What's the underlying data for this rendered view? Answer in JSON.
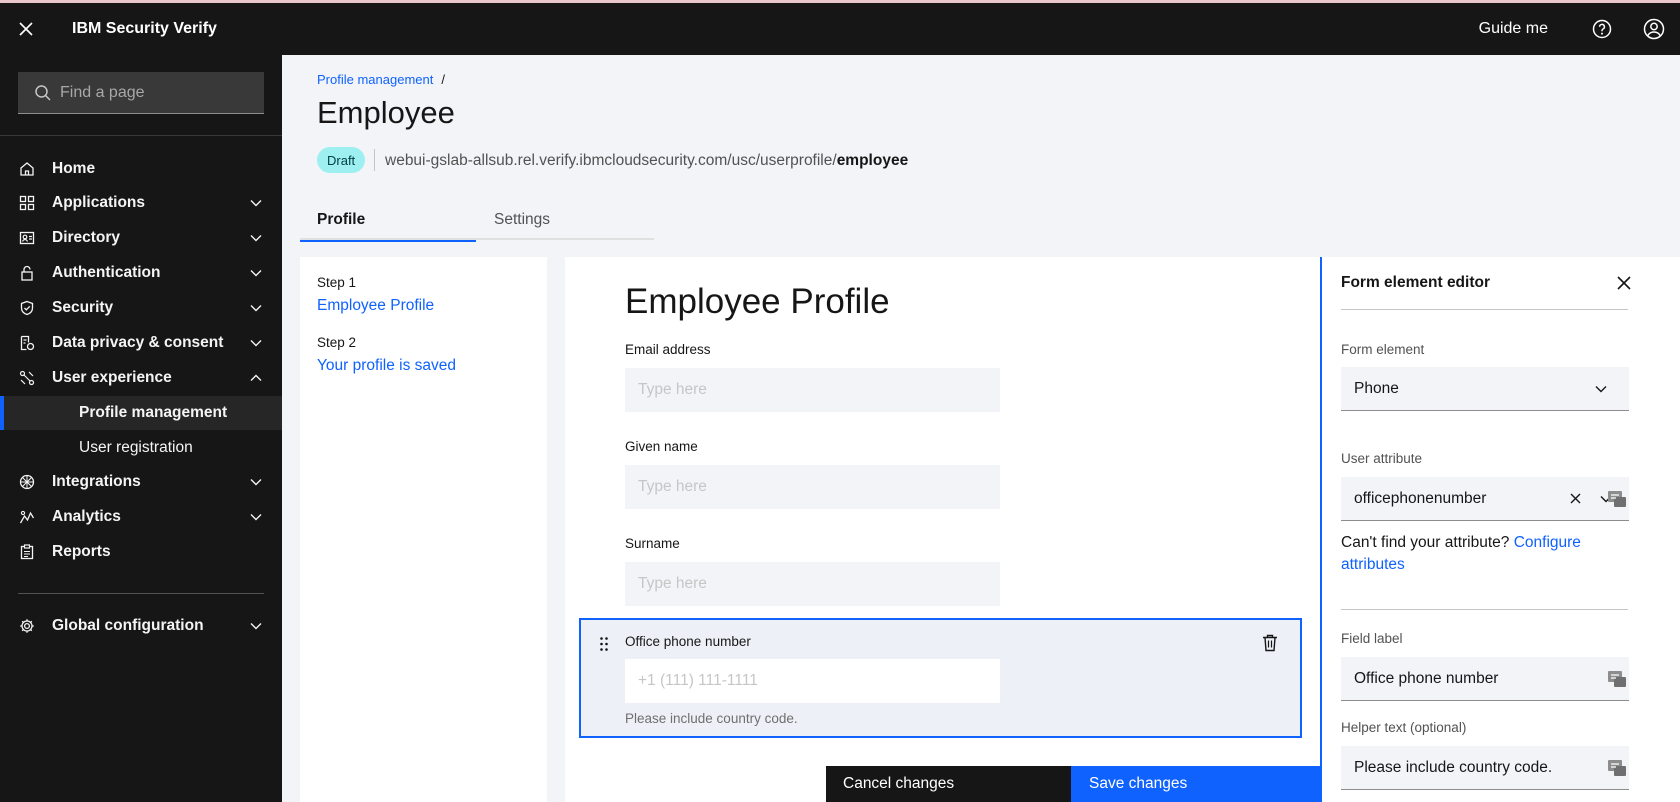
{
  "header": {
    "brand": "IBM Security Verify",
    "guide_me": "Guide me"
  },
  "sidebar": {
    "search_placeholder": "Find a page",
    "items": [
      {
        "label": "Home",
        "icon": "home-icon"
      },
      {
        "label": "Applications",
        "icon": "applications-icon"
      },
      {
        "label": "Directory",
        "icon": "directory-icon"
      },
      {
        "label": "Authentication",
        "icon": "lock-icon"
      },
      {
        "label": "Security",
        "icon": "shield-icon"
      },
      {
        "label": "Data privacy & consent",
        "icon": "data-privacy-icon"
      },
      {
        "label": "User experience",
        "icon": "user-experience-icon"
      },
      {
        "label": "Integrations",
        "icon": "integrations-icon"
      },
      {
        "label": "Analytics",
        "icon": "analytics-icon"
      },
      {
        "label": "Reports",
        "icon": "reports-icon"
      },
      {
        "label": "Global configuration",
        "icon": "gear-icon"
      }
    ],
    "sub_items": [
      {
        "label": "Profile management"
      },
      {
        "label": "User registration"
      }
    ]
  },
  "main": {
    "breadcrumb": "Profile management",
    "breadcrumb_sep": "/",
    "title": "Employee",
    "status_badge": "Draft",
    "url_prefix": "webui-gslab-allsub.rel.verify.ibmcloudsecurity.com/usc/userprofile/",
    "url_suffix": "employee",
    "tabs": [
      {
        "label": "Profile"
      },
      {
        "label": "Settings"
      }
    ],
    "steps": [
      {
        "label": "Step 1",
        "link": "Employee Profile"
      },
      {
        "label": "Step 2",
        "link": "Your profile is saved"
      }
    ],
    "form": {
      "title": "Employee Profile",
      "fields": [
        {
          "label": "Email address",
          "placeholder": "Type here"
        },
        {
          "label": "Given name",
          "placeholder": "Type here"
        },
        {
          "label": "Surname",
          "placeholder": "Type here"
        }
      ],
      "selected_field": {
        "label": "Office phone number",
        "placeholder": "+1 (111) 111-1111",
        "helper": "Please include country code."
      }
    },
    "actions": {
      "cancel": "Cancel changes",
      "save": "Save changes"
    }
  },
  "editor": {
    "title": "Form element editor",
    "form_element_label": "Form element",
    "form_element_value": "Phone",
    "user_attribute_label": "User attribute",
    "user_attribute_value": "officephonenumber",
    "cant_find": "Can't find your attribute?",
    "configure_link": "Configure attributes",
    "field_label_label": "Field label",
    "field_label_value": "Office phone number",
    "helper_text_label": "Helper text (optional)",
    "helper_text_value": "Please include country code."
  },
  "colors": {
    "accent": "#0f62fe",
    "sidebar_bg": "#161616",
    "badge_bg": "#9ef0f0"
  }
}
